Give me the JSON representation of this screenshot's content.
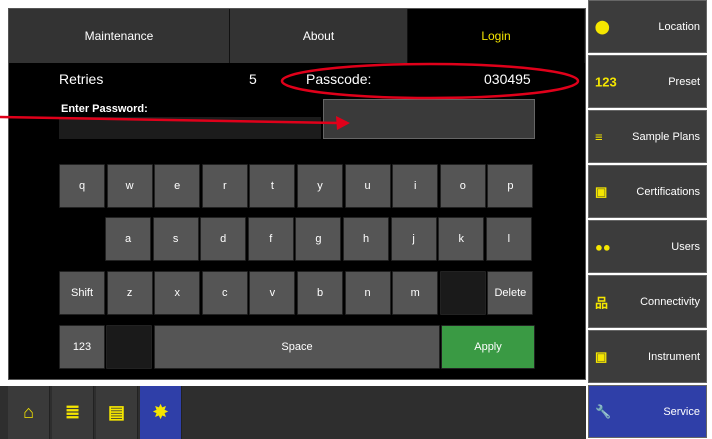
{
  "tabs": [
    {
      "label": "Maintenance"
    },
    {
      "label": "About"
    },
    {
      "label": "Login"
    }
  ],
  "form": {
    "retries_label": "Retries",
    "retries_value": "5",
    "passcode_label": "Passcode:",
    "passcode_value": "030495",
    "enter_password_label": "Enter Password:",
    "password_value": ""
  },
  "keyboard": {
    "row1": [
      "q",
      "w",
      "e",
      "r",
      "t",
      "y",
      "u",
      "i",
      "o",
      "p"
    ],
    "row2": [
      "a",
      "s",
      "d",
      "f",
      "g",
      "h",
      "j",
      "k",
      "l"
    ],
    "row3": [
      "Shift",
      "z",
      "x",
      "c",
      "v",
      "b",
      "n",
      "m",
      "",
      "Delete"
    ],
    "row4": [
      "123",
      "",
      "Space",
      "Apply"
    ]
  },
  "sidebar": [
    {
      "label": "Location",
      "icon": "location-pin-icon",
      "glyph": "⬤"
    },
    {
      "label": "Preset",
      "icon": "numbers-icon",
      "glyph": "123"
    },
    {
      "label": "Sample Plans",
      "icon": "list-arrow-icon",
      "glyph": "≡"
    },
    {
      "label": "Certifications",
      "icon": "certificate-icon",
      "glyph": "▣"
    },
    {
      "label": "Users",
      "icon": "users-icon",
      "glyph": "●●"
    },
    {
      "label": "Connectivity",
      "icon": "network-icon",
      "glyph": "品"
    },
    {
      "label": "Instrument",
      "icon": "instrument-icon",
      "glyph": "▣"
    },
    {
      "label": "Service",
      "icon": "wrench-icon",
      "glyph": "🔧"
    }
  ],
  "bottombar": [
    {
      "icon": "home-icon",
      "glyph": "⌂"
    },
    {
      "icon": "list-icon",
      "glyph": "≣"
    },
    {
      "icon": "document-icon",
      "glyph": "▤"
    },
    {
      "icon": "gear-icon",
      "glyph": "✸"
    }
  ],
  "colors": {
    "accent": "#f5e600",
    "active_blue": "#2f3fa8",
    "apply_green": "#3a9a44",
    "annotation_red": "#e0001a"
  }
}
